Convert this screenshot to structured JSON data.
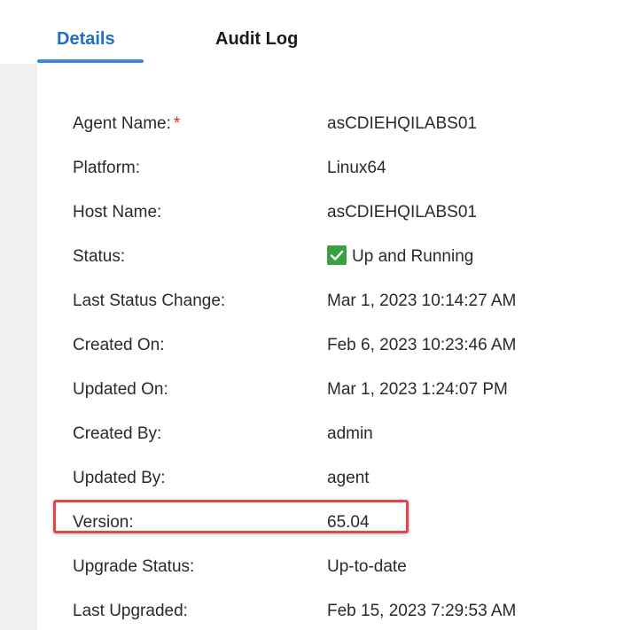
{
  "tabs": {
    "details": "Details",
    "audit_log": "Audit Log"
  },
  "fields": {
    "agent_name": {
      "label": "Agent Name:",
      "required_mark": "*",
      "value": "asCDIEHQILABS01"
    },
    "platform": {
      "label": "Platform:",
      "value": "Linux64"
    },
    "host_name": {
      "label": "Host Name:",
      "value": "asCDIEHQILABS01"
    },
    "status": {
      "label": "Status:",
      "value": "Up and Running",
      "icon": "check-icon",
      "color": "#3aa13f"
    },
    "last_status_change": {
      "label": "Last Status Change:",
      "value": "Mar 1, 2023 10:14:27 AM"
    },
    "created_on": {
      "label": "Created On:",
      "value": "Feb 6, 2023 10:23:46 AM"
    },
    "updated_on": {
      "label": "Updated On:",
      "value": "Mar 1, 2023 1:24:07 PM"
    },
    "created_by": {
      "label": "Created By:",
      "value": "admin"
    },
    "updated_by": {
      "label": "Updated By:",
      "value": "agent"
    },
    "version": {
      "label": "Version:",
      "value": "65.04"
    },
    "upgrade_status": {
      "label": "Upgrade Status:",
      "value": "Up-to-date"
    },
    "last_upgraded": {
      "label": "Last Upgraded:",
      "value": "Feb 15, 2023 7:29:53 AM"
    }
  },
  "colors": {
    "active_tab": "#1f6fc4",
    "tab_underline": "#3b8ad9",
    "required": "#e0301e",
    "highlight": "#e0474c"
  }
}
